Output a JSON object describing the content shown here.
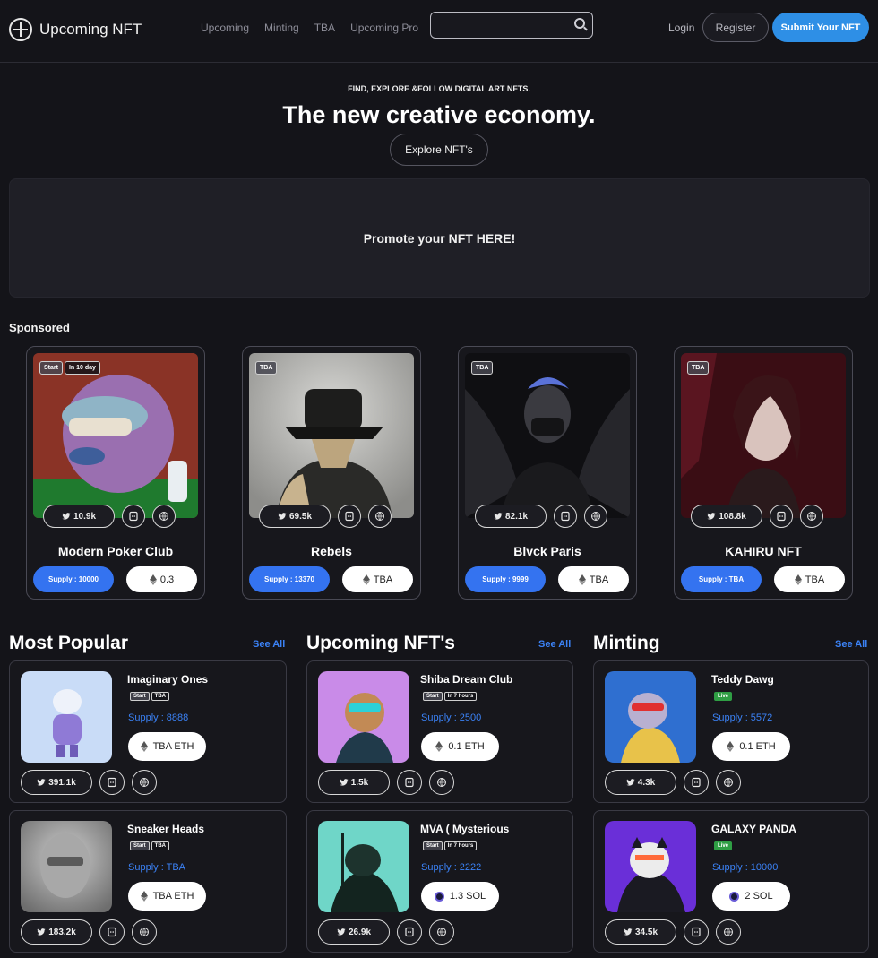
{
  "header": {
    "brand": "Upcoming NFT",
    "nav": [
      "Upcoming",
      "Minting",
      "TBA",
      "Upcoming Pro"
    ],
    "search_placeholder": "",
    "login": "Login",
    "register": "Register",
    "submit": "Submit Your NFT"
  },
  "hero": {
    "tagline": "FIND, EXPLORE &FOLLOW DIGITAL ART NFTS.",
    "title": "The new creative economy.",
    "cta": "Explore NFT's",
    "promo": "Promote your NFT HERE!"
  },
  "sponsored": {
    "title": "Sponsored",
    "cards": [
      {
        "name": "Modern Poker Club",
        "badges": [
          "Start",
          "In 10 day"
        ],
        "twitter": "10.9k",
        "supply": "Supply : 10000",
        "price": "0.3"
      },
      {
        "name": "Rebels",
        "badges": [
          "TBA"
        ],
        "twitter": "69.5k",
        "supply": "Supply : 13370",
        "price": "TBA"
      },
      {
        "name": "Blvck Paris",
        "badges": [
          "TBA"
        ],
        "twitter": "82.1k",
        "supply": "Supply : 9999",
        "price": "TBA"
      },
      {
        "name": "KAHIRU NFT",
        "badges": [
          "TBA"
        ],
        "twitter": "108.8k",
        "supply": "Supply : TBA",
        "price": "TBA"
      }
    ]
  },
  "sections": [
    {
      "title": "Most Popular",
      "see_all": "See All",
      "items": [
        {
          "name": "Imaginary Ones",
          "badges": [
            "Start",
            "TBA"
          ],
          "supply": "Supply : 8888",
          "price": "TBA ETH",
          "twitter": "391.1k"
        },
        {
          "name": "Sneaker Heads",
          "badges": [
            "Start",
            "TBA"
          ],
          "supply": "Supply : TBA",
          "price": "TBA ETH",
          "twitter": "183.2k"
        }
      ]
    },
    {
      "title": "Upcoming NFT's",
      "see_all": "See All",
      "items": [
        {
          "name": "Shiba Dream Club",
          "badges": [
            "Start",
            "In 7 hours"
          ],
          "supply": "Supply : 2500",
          "price": "0.1 ETH",
          "twitter": "1.5k"
        },
        {
          "name": "MVA ( Mysterious",
          "badges": [
            "Start",
            "In 7 hours"
          ],
          "supply": "Supply : 2222",
          "price": "1.3 SOL",
          "twitter": "26.9k"
        }
      ]
    },
    {
      "title": "Minting",
      "see_all": "See All",
      "items": [
        {
          "name": "Teddy Dawg",
          "badges": [
            "Live"
          ],
          "supply": "Supply : 5572",
          "price": "0.1 ETH",
          "twitter": "4.3k"
        },
        {
          "name": "GALAXY PANDA",
          "badges": [
            "Live"
          ],
          "supply": "Supply : 10000",
          "price": "2 SOL",
          "twitter": "34.5k"
        }
      ]
    }
  ],
  "icons": {
    "twitter": "twitter-icon",
    "discord": "discord-icon",
    "website": "globe-icon",
    "currency_eth": "eth-icon",
    "currency_sol": "sol-icon"
  },
  "colors": {
    "accent": "#3473f0",
    "submit": "#2e8fe6",
    "link": "#3b82f6",
    "live": "#2f9e44",
    "background": "#141419"
  }
}
